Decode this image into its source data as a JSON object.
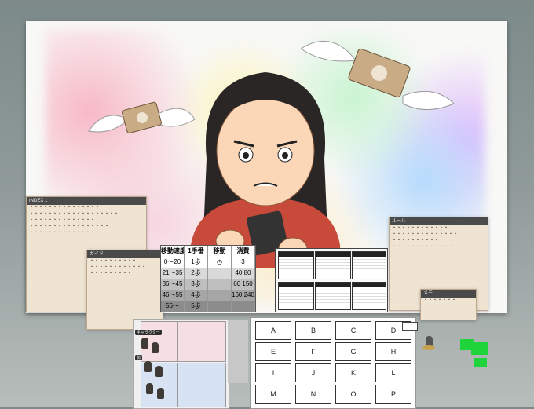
{
  "board": {
    "title": ""
  },
  "speed_table": {
    "headers": [
      "移動速度",
      "1手番",
      "移動",
      "消費"
    ],
    "rows": [
      [
        "0〜20",
        "1歩",
        "",
        "3"
      ],
      [
        "21〜35",
        "2歩",
        "",
        "40 80"
      ],
      [
        "36〜45",
        "3歩",
        "",
        "60 150"
      ],
      [
        "46〜55",
        "4歩",
        "",
        "160 240"
      ],
      [
        "56〜",
        "5歩",
        "",
        ""
      ]
    ]
  },
  "letters": [
    "A",
    "B",
    "C",
    "D",
    "E",
    "F",
    "G",
    "H",
    "I",
    "J",
    "K",
    "L",
    "M",
    "N",
    "O",
    "P"
  ],
  "notes": {
    "left_card_header": "INDEX 1",
    "left_overlay_header": "ガイド",
    "right_card_header": "ルール",
    "right_overlay_header": "メモ"
  },
  "tokens": {
    "tag1": "キャラクター",
    "tag2": "駒"
  },
  "colors": {
    "accent_green": "#1fd43a",
    "card_bg": "#efe3d2"
  }
}
